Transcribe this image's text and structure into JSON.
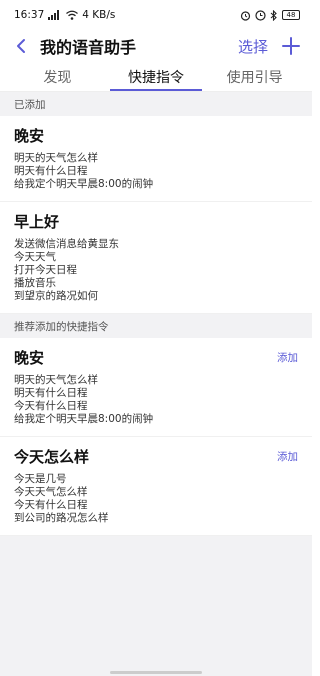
{
  "status_bar": {
    "time": "16:37",
    "network_speed": "4 KB/s",
    "battery": "48",
    "icons": [
      "signal-icon",
      "wifi-icon",
      "alarm-icon",
      "bluetooth-icon",
      "battery-icon"
    ]
  },
  "header": {
    "title": "我的语音助手",
    "select_label": "选择"
  },
  "tabs": [
    {
      "label": "发现",
      "active": false
    },
    {
      "label": "快捷指令",
      "active": true
    },
    {
      "label": "使用引导",
      "active": false
    }
  ],
  "added_section": {
    "header": "已添加",
    "cards": [
      {
        "title": "晚安",
        "lines": [
          "明天的天气怎么样",
          "明天有什么日程",
          "给我定个明天早晨8:00的闹钟"
        ]
      },
      {
        "title": "早上好",
        "lines": [
          "发送微信消息给黄显东",
          "今天天气",
          "打开今天日程",
          "播放音乐",
          "到望京的路况如何"
        ]
      }
    ]
  },
  "recommended_section": {
    "header": "推荐添加的快捷指令",
    "cards": [
      {
        "title": "晚安",
        "add_label": "添加",
        "lines": [
          "明天的天气怎么样",
          "明天有什么日程",
          "今天有什么日程",
          "给我定个明天早晨8:00的闹钟"
        ]
      },
      {
        "title": "今天怎么样",
        "add_label": "添加",
        "lines": [
          "今天是几号",
          "今天天气怎么样",
          "今天有什么日程",
          "到公司的路况怎么样"
        ]
      }
    ]
  },
  "colors": {
    "accent": "#5b5bd6",
    "section_bg": "#f2f2f4"
  }
}
